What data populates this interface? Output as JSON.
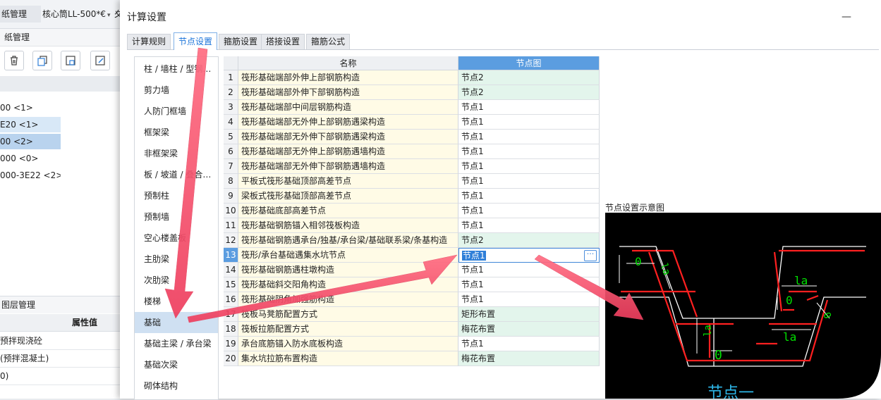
{
  "background_app": {
    "tabs": [
      {
        "label": "纸管理"
      },
      {
        "label": "核心筒LL-500*€"
      },
      {
        "label": "夊"
      }
    ],
    "panel_title": "纸管理",
    "tree_items": [
      {
        "label": "00 <1>"
      },
      {
        "label": "E20 <1>"
      },
      {
        "label": "00 <2>"
      },
      {
        "label": "000 <0>"
      },
      {
        "label": "000-3E22 <2>"
      }
    ],
    "layer_panel_title": "图层管理",
    "property_header": "属性值",
    "property_rows": [
      {
        "label": "预拌现浇砼"
      },
      {
        "label": "(预拌混凝土)"
      },
      {
        "label": "0)"
      }
    ]
  },
  "dialog": {
    "title": "计算设置",
    "minimize_label": "—",
    "tabs": [
      {
        "label": "计算规则"
      },
      {
        "label": "节点设置"
      },
      {
        "label": "箍筋设置"
      },
      {
        "label": "搭接设置"
      },
      {
        "label": "箍筋公式"
      }
    ],
    "active_tab": "节点设置",
    "categories": [
      {
        "label": "柱 / 墙柱 / 型钢…"
      },
      {
        "label": "剪力墙"
      },
      {
        "label": "人防门框墙"
      },
      {
        "label": "框架梁"
      },
      {
        "label": "非框架梁"
      },
      {
        "label": "板 / 坡道 / 叠合…"
      },
      {
        "label": "预制柱"
      },
      {
        "label": "预制墙"
      },
      {
        "label": "空心楼盖板"
      },
      {
        "label": "主肋梁"
      },
      {
        "label": "次肋梁"
      },
      {
        "label": "楼梯"
      },
      {
        "label": "基础"
      },
      {
        "label": "基础主梁 / 承台梁"
      },
      {
        "label": "基础次梁"
      },
      {
        "label": "砌体结构"
      }
    ],
    "selected_category": "基础",
    "table": {
      "headers": {
        "num": "",
        "name": "名称",
        "node": "节点图"
      },
      "rows": [
        {
          "num": "1",
          "name": "筏形基础端部外伸上部钢筋构造",
          "node": "节点2",
          "changed": true
        },
        {
          "num": "2",
          "name": "筏形基础端部外伸下部钢筋构造",
          "node": "节点2",
          "changed": true
        },
        {
          "num": "3",
          "name": "筏形基础端部中间层钢筋构造",
          "node": "节点1"
        },
        {
          "num": "4",
          "name": "筏形基础端部无外伸上部钢筋遇梁构造",
          "node": "节点1"
        },
        {
          "num": "5",
          "name": "筏形基础端部无外伸下部钢筋遇梁构造",
          "node": "节点1"
        },
        {
          "num": "6",
          "name": "筏形基础端部无外伸上部钢筋遇墙构造",
          "node": "节点1"
        },
        {
          "num": "7",
          "name": "筏形基础端部无外伸下部钢筋遇墙构造",
          "node": "节点1"
        },
        {
          "num": "8",
          "name": "平板式筏形基础顶部高差节点",
          "node": "节点1"
        },
        {
          "num": "9",
          "name": "梁板式筏形基础顶部高差节点",
          "node": "节点1"
        },
        {
          "num": "10",
          "name": "筏形基础底部高差节点",
          "node": "节点1"
        },
        {
          "num": "11",
          "name": "筏形基础钢筋锚入相邻筏板构造",
          "node": "节点1"
        },
        {
          "num": "12",
          "name": "筏形基础钢筋遇承台/独基/承台梁/基础联系梁/条基构造",
          "node": "节点2",
          "changed": true
        },
        {
          "num": "13",
          "name": "筏形/承台基础遇集水坑节点",
          "node": "节点1",
          "selected": true
        },
        {
          "num": "14",
          "name": "筏形基础钢筋遇柱墩构造",
          "node": "节点1"
        },
        {
          "num": "15",
          "name": "筏形基础斜交阳角构造",
          "node": "节点1"
        },
        {
          "num": "16",
          "name": "筏形基础阴角加强筋构造",
          "node": "节点1"
        },
        {
          "num": "17",
          "name": "筏板马凳筋配置方式",
          "node": "矩形布置",
          "changed": true
        },
        {
          "num": "18",
          "name": "筏板拉筋配置方式",
          "node": "梅花布置",
          "changed": true
        },
        {
          "num": "19",
          "name": "承台底筋锚入防水底板构造",
          "node": "节点1"
        },
        {
          "num": "20",
          "name": "集水坑拉筋布置构造",
          "node": "梅花布置",
          "changed": true
        }
      ]
    },
    "diagram": {
      "title": "节点设置示意图",
      "caption": "节点一",
      "labels": [
        "0",
        "la",
        "la",
        "0",
        "la",
        "la",
        "0",
        "0"
      ],
      "colors": {
        "rebar": "#ff2020",
        "outline": "#ffffff",
        "dimension": "#00e000",
        "caption": "#2db6e8"
      }
    }
  },
  "annotation_color": "#f2506a"
}
